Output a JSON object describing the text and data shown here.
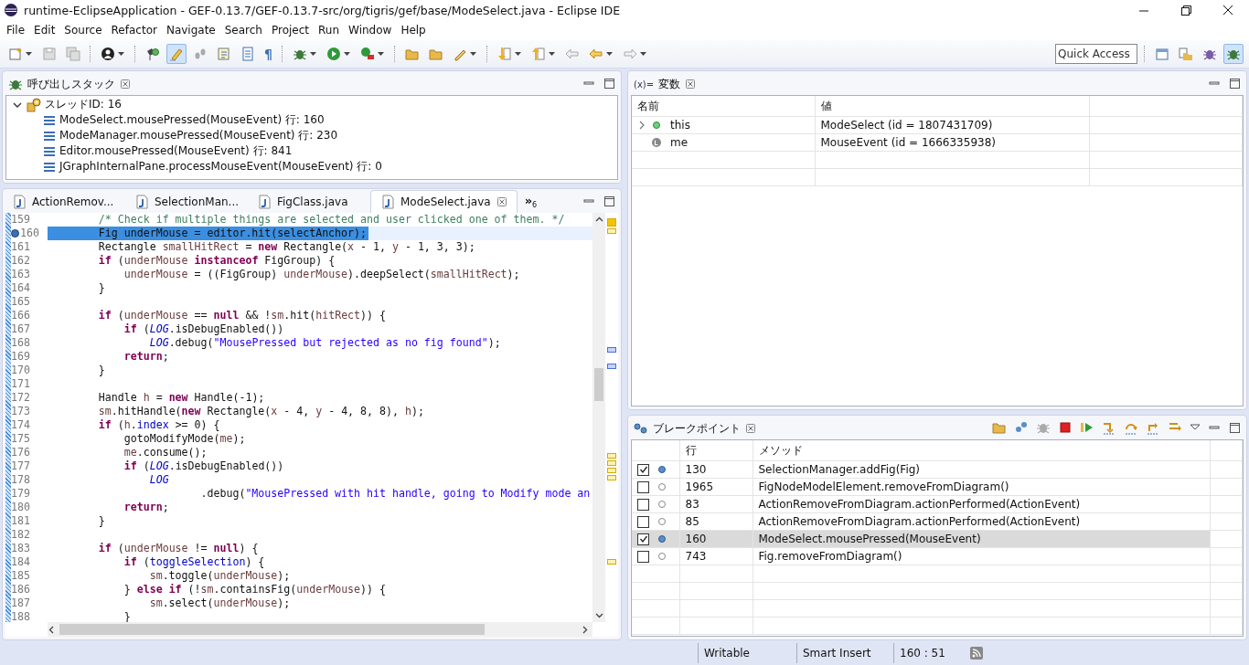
{
  "window": {
    "title": "runtime-EclipseApplication - GEF-0.13.7/GEF-0.13.7-src/org/tigris/gef/base/ModeSelect.java - Eclipse IDE"
  },
  "menu": [
    "File",
    "Edit",
    "Source",
    "Refactor",
    "Navigate",
    "Search",
    "Project",
    "Run",
    "Window",
    "Help"
  ],
  "toolbar": {
    "pilcrow": "¶",
    "highlight_toggle": {
      "on": true
    },
    "quick_access": {
      "placeholder": "Quick Access"
    },
    "perspectives": [
      {
        "selected": false
      },
      {
        "selected": false
      },
      {
        "selected": false
      },
      {
        "selected": true
      }
    ]
  },
  "call_stack": {
    "title": "呼び出しスタック",
    "thread": {
      "label": "スレッドID: 16",
      "expanded": true,
      "frames": [
        "ModeSelect.mousePressed(MouseEvent) 行: 160",
        "ModeManager.mousePressed(MouseEvent) 行: 230",
        "Editor.mousePressed(MouseEvent) 行: 841",
        "JGraphInternalPane.processMouseEvent(MouseEvent) 行: 0"
      ]
    }
  },
  "editor": {
    "tabs": [
      {
        "label": "ActionRemov...",
        "selected": false
      },
      {
        "label": "SelectionMan...",
        "selected": false
      },
      {
        "label": "FigClass.java",
        "selected": false
      },
      {
        "label": "ModeSelect.java",
        "selected": true
      }
    ],
    "overflow": {
      "symbol": "»",
      "count": "6"
    },
    "lines": [
      {
        "number": "159",
        "breakpoint": false,
        "selected": false,
        "tokens": [
          {
            "kind": "comment",
            "text": "        /* Check if multiple things are selected and user clicked one of them. */"
          }
        ]
      },
      {
        "number": "160",
        "breakpoint": true,
        "selected": true,
        "tokens": [
          {
            "kind": "plain",
            "text": "        Fig underMouse = editor.hit(selectAnchor);"
          }
        ]
      },
      {
        "number": "161",
        "breakpoint": false,
        "selected": false,
        "tokens": [
          {
            "kind": "plain",
            "text": "        Rectangle "
          },
          {
            "kind": "local",
            "text": "smallHitRect"
          },
          {
            "kind": "plain",
            "text": " = "
          },
          {
            "kind": "keyword",
            "text": "new"
          },
          {
            "kind": "plain",
            "text": " Rectangle("
          },
          {
            "kind": "local",
            "text": "x"
          },
          {
            "kind": "plain",
            "text": " - 1, "
          },
          {
            "kind": "local",
            "text": "y"
          },
          {
            "kind": "plain",
            "text": " - 1, 3, 3);"
          }
        ]
      },
      {
        "number": "162",
        "breakpoint": false,
        "selected": false,
        "tokens": [
          {
            "kind": "keyword",
            "text": "        if"
          },
          {
            "kind": "plain",
            "text": " ("
          },
          {
            "kind": "local",
            "text": "underMouse"
          },
          {
            "kind": "keyword",
            "text": " instanceof"
          },
          {
            "kind": "plain",
            "text": " FigGroup) {"
          }
        ]
      },
      {
        "number": "163",
        "breakpoint": false,
        "selected": false,
        "tokens": [
          {
            "kind": "local",
            "text": "            underMouse"
          },
          {
            "kind": "plain",
            "text": " = ((FigGroup) "
          },
          {
            "kind": "local",
            "text": "underMouse"
          },
          {
            "kind": "plain",
            "text": ").deepSelect("
          },
          {
            "kind": "local",
            "text": "smallHitRect"
          },
          {
            "kind": "plain",
            "text": ");"
          }
        ]
      },
      {
        "number": "164",
        "breakpoint": false,
        "selected": false,
        "tokens": [
          {
            "kind": "plain",
            "text": "        }"
          }
        ]
      },
      {
        "number": "165",
        "breakpoint": false,
        "selected": false
      },
      {
        "number": "166",
        "breakpoint": false,
        "selected": false,
        "tokens": [
          {
            "kind": "keyword",
            "text": "        if"
          },
          {
            "kind": "plain",
            "text": " ("
          },
          {
            "kind": "local",
            "text": "underMouse"
          },
          {
            "kind": "plain",
            "text": " == "
          },
          {
            "kind": "keyword",
            "text": "null"
          },
          {
            "kind": "plain",
            "text": " && !"
          },
          {
            "kind": "local",
            "text": "sm"
          },
          {
            "kind": "plain",
            "text": ".hit("
          },
          {
            "kind": "local",
            "text": "hitRect"
          },
          {
            "kind": "plain",
            "text": ")) {"
          }
        ]
      },
      {
        "number": "167",
        "breakpoint": false,
        "selected": false,
        "tokens": [
          {
            "kind": "keyword",
            "text": "            if"
          },
          {
            "kind": "plain",
            "text": " ("
          },
          {
            "kind": "static",
            "text": "LOG"
          },
          {
            "kind": "plain",
            "text": ".isDebugEnabled())"
          }
        ]
      },
      {
        "number": "168",
        "breakpoint": false,
        "selected": false,
        "tokens": [
          {
            "kind": "static",
            "text": "                LOG"
          },
          {
            "kind": "plain",
            "text": ".debug("
          },
          {
            "kind": "string",
            "text": "\"MousePressed but rejected as no fig found\""
          },
          {
            "kind": "plain",
            "text": ");"
          }
        ]
      },
      {
        "number": "169",
        "breakpoint": false,
        "selected": false,
        "tokens": [
          {
            "kind": "keyword",
            "text": "            return"
          },
          {
            "kind": "plain",
            "text": ";"
          }
        ]
      },
      {
        "number": "170",
        "breakpoint": false,
        "selected": false,
        "tokens": [
          {
            "kind": "plain",
            "text": "        }"
          }
        ]
      },
      {
        "number": "171",
        "breakpoint": false,
        "selected": false
      },
      {
        "number": "172",
        "breakpoint": false,
        "selected": false,
        "tokens": [
          {
            "kind": "plain",
            "text": "        Handle "
          },
          {
            "kind": "local",
            "text": "h"
          },
          {
            "kind": "plain",
            "text": " = "
          },
          {
            "kind": "keyword",
            "text": "new"
          },
          {
            "kind": "plain",
            "text": " Handle(-1);"
          }
        ]
      },
      {
        "number": "173",
        "breakpoint": false,
        "selected": false,
        "tokens": [
          {
            "kind": "local",
            "text": "        sm"
          },
          {
            "kind": "plain",
            "text": ".hitHandle("
          },
          {
            "kind": "keyword",
            "text": "new"
          },
          {
            "kind": "plain",
            "text": " Rectangle("
          },
          {
            "kind": "local",
            "text": "x"
          },
          {
            "kind": "plain",
            "text": " - 4, "
          },
          {
            "kind": "local",
            "text": "y"
          },
          {
            "kind": "plain",
            "text": " - 4, 8, 8), "
          },
          {
            "kind": "local",
            "text": "h"
          },
          {
            "kind": "plain",
            "text": ");"
          }
        ]
      },
      {
        "number": "174",
        "breakpoint": false,
        "selected": false,
        "tokens": [
          {
            "kind": "keyword",
            "text": "        if"
          },
          {
            "kind": "plain",
            "text": " ("
          },
          {
            "kind": "local",
            "text": "h"
          },
          {
            "kind": "plain",
            "text": "."
          },
          {
            "kind": "field",
            "text": "index"
          },
          {
            "kind": "plain",
            "text": " >= 0) {"
          }
        ]
      },
      {
        "number": "175",
        "breakpoint": false,
        "selected": false,
        "tokens": [
          {
            "kind": "plain",
            "text": "            gotoModifyMode("
          },
          {
            "kind": "local",
            "text": "me"
          },
          {
            "kind": "plain",
            "text": ");"
          }
        ]
      },
      {
        "number": "176",
        "breakpoint": false,
        "selected": false,
        "tokens": [
          {
            "kind": "local",
            "text": "            me"
          },
          {
            "kind": "plain",
            "text": ".consume();"
          }
        ]
      },
      {
        "number": "177",
        "breakpoint": false,
        "selected": false,
        "tokens": [
          {
            "kind": "keyword",
            "text": "            if"
          },
          {
            "kind": "plain",
            "text": " ("
          },
          {
            "kind": "static",
            "text": "LOG"
          },
          {
            "kind": "plain",
            "text": ".isDebugEnabled())"
          }
        ]
      },
      {
        "number": "178",
        "breakpoint": false,
        "selected": false,
        "tokens": [
          {
            "kind": "static",
            "text": "                LOG"
          }
        ]
      },
      {
        "number": "179",
        "breakpoint": false,
        "selected": false,
        "tokens": [
          {
            "kind": "plain",
            "text": "                        .debug("
          },
          {
            "kind": "string",
            "text": "\"MousePressed with hit handle, going to Modify mode an"
          }
        ]
      },
      {
        "number": "180",
        "breakpoint": false,
        "selected": false,
        "tokens": [
          {
            "kind": "keyword",
            "text": "            return"
          },
          {
            "kind": "plain",
            "text": ";"
          }
        ]
      },
      {
        "number": "181",
        "breakpoint": false,
        "selected": false,
        "tokens": [
          {
            "kind": "plain",
            "text": "        }"
          }
        ]
      },
      {
        "number": "182",
        "breakpoint": false,
        "selected": false
      },
      {
        "number": "183",
        "breakpoint": false,
        "selected": false,
        "tokens": [
          {
            "kind": "keyword",
            "text": "        if"
          },
          {
            "kind": "plain",
            "text": " ("
          },
          {
            "kind": "local",
            "text": "underMouse"
          },
          {
            "kind": "plain",
            "text": " != "
          },
          {
            "kind": "keyword",
            "text": "null"
          },
          {
            "kind": "plain",
            "text": ") {"
          }
        ]
      },
      {
        "number": "184",
        "breakpoint": false,
        "selected": false,
        "tokens": [
          {
            "kind": "keyword",
            "text": "            if"
          },
          {
            "kind": "plain",
            "text": " ("
          },
          {
            "kind": "field",
            "text": "toggleSelection"
          },
          {
            "kind": "plain",
            "text": ") {"
          }
        ]
      },
      {
        "number": "185",
        "breakpoint": false,
        "selected": false,
        "tokens": [
          {
            "kind": "local",
            "text": "                sm"
          },
          {
            "kind": "plain",
            "text": ".toggle("
          },
          {
            "kind": "local",
            "text": "underMouse"
          },
          {
            "kind": "plain",
            "text": ");"
          }
        ]
      },
      {
        "number": "186",
        "breakpoint": false,
        "selected": false,
        "tokens": [
          {
            "kind": "plain",
            "text": "            } "
          },
          {
            "kind": "keyword",
            "text": "else if"
          },
          {
            "kind": "plain",
            "text": " (!"
          },
          {
            "kind": "local",
            "text": "sm"
          },
          {
            "kind": "plain",
            "text": ".containsFig("
          },
          {
            "kind": "local",
            "text": "underMouse"
          },
          {
            "kind": "plain",
            "text": ")) {"
          }
        ]
      },
      {
        "number": "187",
        "breakpoint": false,
        "selected": false,
        "tokens": [
          {
            "kind": "local",
            "text": "                sm"
          },
          {
            "kind": "plain",
            "text": ".select("
          },
          {
            "kind": "local",
            "text": "underMouse"
          },
          {
            "kind": "plain",
            "text": ");"
          }
        ]
      },
      {
        "number": "188",
        "breakpoint": false,
        "selected": false,
        "tokens": [
          {
            "kind": "plain",
            "text": "            }"
          }
        ]
      }
    ]
  },
  "variables": {
    "prefix": "(x)=",
    "title": "変数",
    "columns": [
      "名前",
      "値"
    ],
    "rows": [
      {
        "kind": "field",
        "expandable": true,
        "name": "this",
        "value": "ModeSelect (id = 1807431709)"
      },
      {
        "kind": "local",
        "expandable": false,
        "name": "me",
        "value": "MouseEvent (id = 1666335938)"
      }
    ]
  },
  "breakpoints": {
    "title": "ブレークポイント",
    "columns": [
      "行",
      "メソッド"
    ],
    "rows": [
      {
        "checked": true,
        "selected": false,
        "line": "130",
        "method": "SelectionManager.addFig(Fig)"
      },
      {
        "checked": false,
        "selected": false,
        "line": "1965",
        "method": "FigNodeModelElement.removeFromDiagram()"
      },
      {
        "checked": false,
        "selected": false,
        "line": "83",
        "method": "ActionRemoveFromDiagram.actionPerformed(ActionEvent)"
      },
      {
        "checked": false,
        "selected": false,
        "line": "85",
        "method": "ActionRemoveFromDiagram.actionPerformed(ActionEvent)"
      },
      {
        "checked": true,
        "selected": true,
        "line": "160",
        "method": "ModeSelect.mousePressed(MouseEvent)"
      },
      {
        "checked": false,
        "selected": false,
        "line": "743",
        "method": "Fig.removeFromDiagram()"
      }
    ]
  },
  "status_bar": [
    "Writable",
    "Smart Insert",
    "160 : 51"
  ]
}
